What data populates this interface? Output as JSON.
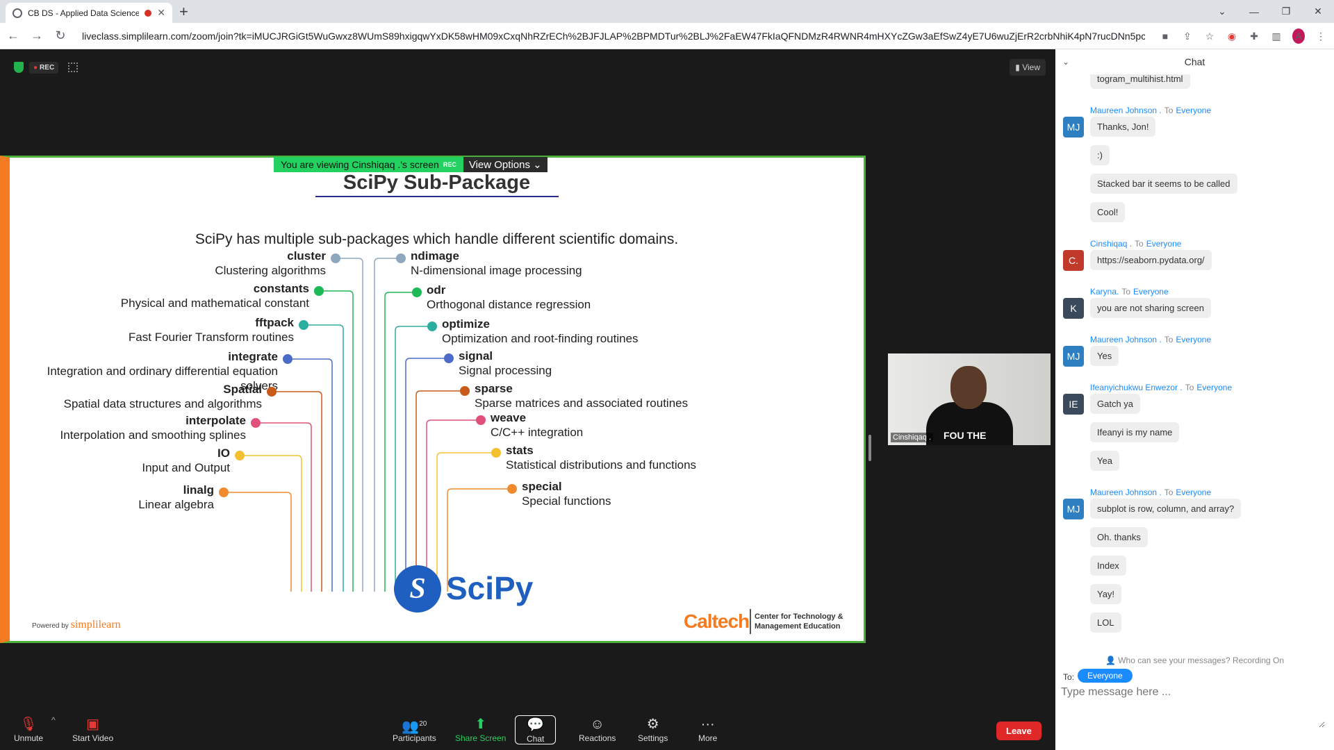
{
  "browser": {
    "tab_title": "CB DS - Applied Data Science",
    "url": "liveclass.simplilearn.com/zoom/join?tk=iMUCJRGiGt5WuGwxz8WUmS89hxigqwYxDK58wHM09xCxqNhRZrECh%2BJFJLAP%2BPMDTur%2BLJ%2FaEW47FkIaQFNDMzR4RWNR4mHXYcZGw3aEfSwZ4yE7U6wuZjErR2crbNhiK4pN7rucDNn5pcxSOy6...",
    "profile_initial": "A"
  },
  "meeting": {
    "rec_label": "REC",
    "view_label": "View",
    "viewing_banner": "You are viewing Cinshiqaq .'s screen",
    "viewing_rec": "REC",
    "view_options": "View Options ⌄",
    "video_name": "Cinshiqaq .",
    "video_shirt_text": "FOU THE"
  },
  "slide": {
    "title": "SciPy Sub-Package",
    "subtitle": "SciPy has multiple sub-packages which handle different scientific domains.",
    "left_packages": [
      {
        "name": "cluster",
        "desc": "Clustering algorithms",
        "color": "#8fa8c0"
      },
      {
        "name": "constants",
        "desc": "Physical and mathematical constant",
        "color": "#1db954"
      },
      {
        "name": "fftpack",
        "desc": "Fast Fourier Transform routines",
        "color": "#2aaea0"
      },
      {
        "name": "integrate",
        "desc": "Integration and ordinary differential equation solvers",
        "color": "#4a6cc8"
      },
      {
        "name": "Spatial",
        "desc": "Spatial data structures and algorithms",
        "color": "#c85a1a"
      },
      {
        "name": "interpolate",
        "desc": "Interpolation and smoothing splines",
        "color": "#e0507a"
      },
      {
        "name": "IO",
        "desc": "Input and Output",
        "color": "#f5c030"
      },
      {
        "name": "linalg",
        "desc": "Linear algebra",
        "color": "#f08a30"
      }
    ],
    "right_packages": [
      {
        "name": "ndimage",
        "desc": "N-dimensional image processing",
        "color": "#8fa8c0"
      },
      {
        "name": "odr",
        "desc": "Orthogonal distance regression",
        "color": "#1db954"
      },
      {
        "name": "optimize",
        "desc": "Optimization and root-finding routines",
        "color": "#2aaea0"
      },
      {
        "name": "signal",
        "desc": "Signal processing",
        "color": "#4a6cc8"
      },
      {
        "name": "sparse",
        "desc": "Sparse matrices and associated routines",
        "color": "#c85a1a"
      },
      {
        "name": "weave",
        "desc": "C/C++ integration",
        "color": "#e0507a"
      },
      {
        "name": "stats",
        "desc": "Statistical distributions and functions",
        "color": "#f5c030"
      },
      {
        "name": "special",
        "desc": "Special functions",
        "color": "#f08a30"
      }
    ],
    "logo_text": "SciPy",
    "logo_mark": "S",
    "powered_by": "Powered by",
    "brand": "simplilearn",
    "caltech": "Caltech",
    "caltech_desc_1": "Center for Technology &",
    "caltech_desc_2": "Management Education"
  },
  "toolbar": {
    "unmute": "Unmute",
    "start_video": "Start Video",
    "participants": "Participants",
    "participants_count": "20",
    "share_screen": "Share Screen",
    "chat": "Chat",
    "reactions": "Reactions",
    "settings": "Settings",
    "more": "More",
    "leave": "Leave"
  },
  "chat": {
    "header": "Chat",
    "to_everyone": "To",
    "everyone": "Everyone",
    "who_can_see": "Who can see your messages? Recording On",
    "to_label": "To:",
    "to_value": "Everyone",
    "input_placeholder": "Type message here ...",
    "entries": [
      {
        "type": "bubble",
        "text": "togram_multihist.html"
      },
      {
        "type": "sender",
        "name": "Maureen Johnson .",
        "initials": "MJ",
        "color": "#2d7fc1"
      },
      {
        "type": "bubble",
        "text": "Thanks, Jon!"
      },
      {
        "type": "bubble",
        "text": ":)"
      },
      {
        "type": "bubble",
        "text": "Stacked bar it seems to be called"
      },
      {
        "type": "bubble",
        "text": "Cool!"
      },
      {
        "type": "sender",
        "name": "Cinshiqaq .",
        "initials": "C.",
        "color": "#c0392b"
      },
      {
        "type": "bubble",
        "text": "https://seaborn.pydata.org/"
      },
      {
        "type": "sender",
        "name": "Karyna.",
        "initials": "K",
        "color": "#3a4a5c"
      },
      {
        "type": "bubble",
        "text": "you are not sharing screen"
      },
      {
        "type": "sender",
        "name": "Maureen Johnson .",
        "initials": "MJ",
        "color": "#2d7fc1"
      },
      {
        "type": "bubble",
        "text": "Yes"
      },
      {
        "type": "sender",
        "name": "Ifeanyichukwu Enwezor .",
        "initials": "IE",
        "color": "#3a4a5c"
      },
      {
        "type": "bubble",
        "text": "Gatch ya"
      },
      {
        "type": "bubble",
        "text": "Ifeanyi is my name"
      },
      {
        "type": "bubble",
        "text": "Yea"
      },
      {
        "type": "sender",
        "name": "Maureen Johnson .",
        "initials": "MJ",
        "color": "#2d7fc1"
      },
      {
        "type": "bubble",
        "text": "subplot is row, column, and array?"
      },
      {
        "type": "bubble",
        "text": "Oh. thanks"
      },
      {
        "type": "bubble",
        "text": "Index"
      },
      {
        "type": "bubble",
        "text": "Yay!"
      },
      {
        "type": "bubble",
        "text": "LOL"
      }
    ]
  }
}
